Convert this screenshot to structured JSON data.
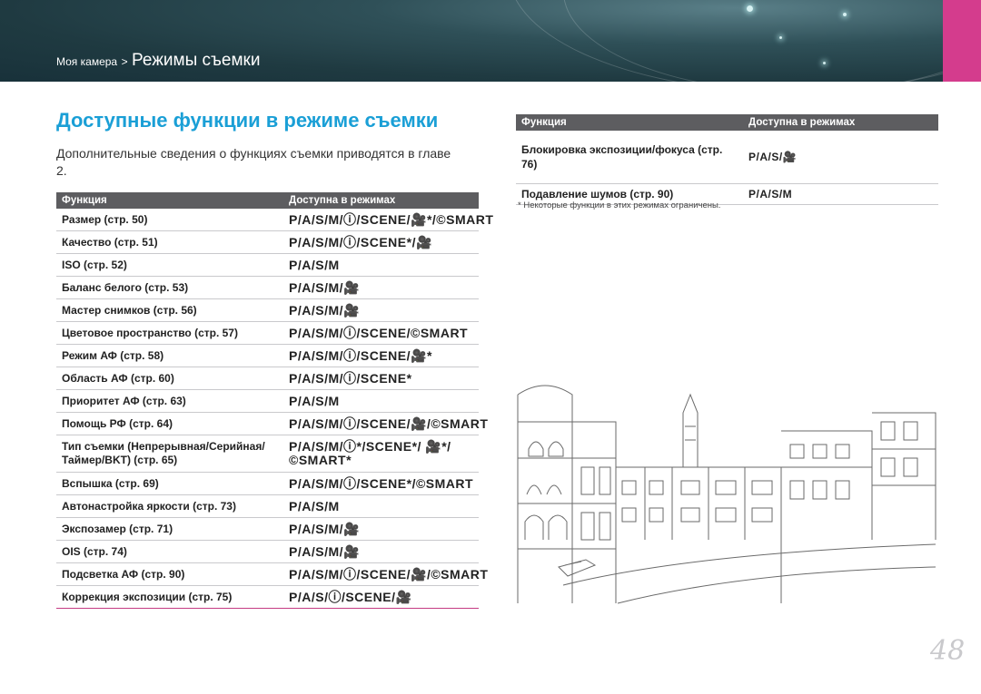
{
  "header": {
    "breadcrumb_parent": "Моя камера",
    "breadcrumb_sep": ">",
    "breadcrumb_current": "Режимы съемки",
    "accent_color": "#d43c8d"
  },
  "main": {
    "title": "Доступные функции в режиме съемки",
    "intro": "Дополнительные сведения о функциях съемки приводятся в главе 2.",
    "table_left": {
      "headers": [
        "Функция",
        "Доступна в режимах"
      ],
      "rows": [
        {
          "function": "Размер (стр. 50)",
          "modes": "P/A/S/M/ⓘ/SCENE/🎥*/©SMART"
        },
        {
          "function": "Качество (стр. 51)",
          "modes": "P/A/S/M/ⓘ/SCENE*/🎥"
        },
        {
          "function": "ISO (стр. 52)",
          "modes": "P/A/S/M"
        },
        {
          "function": "Баланс белого (стр. 53)",
          "modes": "P/A/S/M/🎥"
        },
        {
          "function": "Мастер снимков (стр. 56)",
          "modes": "P/A/S/M/🎥"
        },
        {
          "function": "Цветовое пространство (стр. 57)",
          "modes": "P/A/S/M/ⓘ/SCENE/©SMART"
        },
        {
          "function": "Режим АФ (стр. 58)",
          "modes": "P/A/S/M/ⓘ/SCENE/🎥*"
        },
        {
          "function": "Область АФ (стр. 60)",
          "modes": "P/A/S/M/ⓘ/SCENE*"
        },
        {
          "function": "Приоритет АФ (стр. 63)",
          "modes": "P/A/S/M"
        },
        {
          "function": "Помощь РФ (стр. 64)",
          "modes": "P/A/S/M/ⓘ/SCENE/🎥/©SMART"
        },
        {
          "function": "Тип съемки (Непрерывная/Серийная/ Таймер/BKT) (стр. 65)",
          "modes": "P/A/S/M/ⓘ*/SCENE*/ 🎥*/©SMART*"
        },
        {
          "function": "Вспышка (стр. 69)",
          "modes": "P/A/S/M/ⓘ/SCENE*/©SMART"
        },
        {
          "function": "Автонастройка яркости (стр. 73)",
          "modes": "P/A/S/M"
        },
        {
          "function": "Экспозамер (стр. 71)",
          "modes": "P/A/S/M/🎥"
        },
        {
          "function": "OIS (стр. 74)",
          "modes": "P/A/S/M/🎥"
        },
        {
          "function": "Подсветка АФ (стр. 90)",
          "modes": "P/A/S/M/ⓘ/SCENE/🎥/©SMART"
        },
        {
          "function": "Коррекция экспозиции (стр. 75)",
          "modes": "P/A/S/ⓘ/SCENE/🎥"
        }
      ]
    },
    "table_right": {
      "headers": [
        "Функция",
        "Доступна в режимах"
      ],
      "rows": [
        {
          "function": "Блокировка экспозиции/фокуса (стр. 76)",
          "modes": "P/A/S/🎥"
        },
        {
          "function": "Подавление шумов (стр. 90)",
          "modes": "P/A/S/M"
        }
      ]
    },
    "footnote": "* Некоторые функции в этих режимах ограничены.",
    "page_number": "48"
  }
}
